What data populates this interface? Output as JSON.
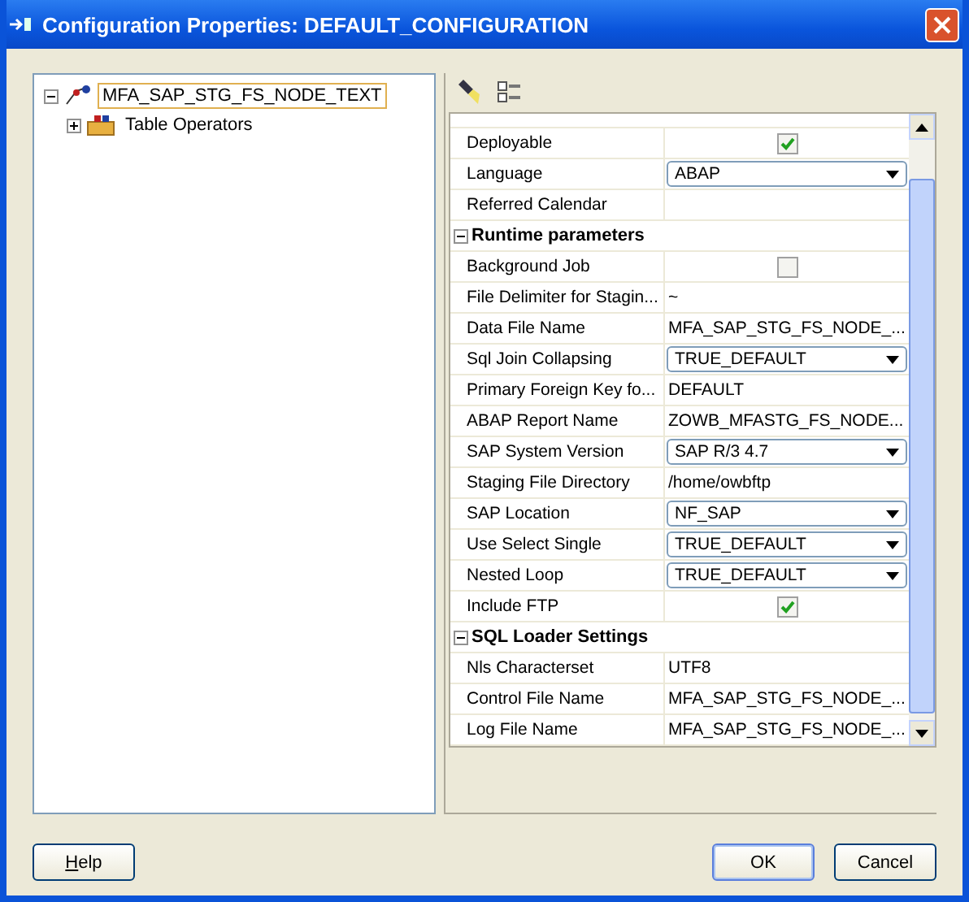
{
  "window": {
    "title": "Configuration Properties: DEFAULT_CONFIGURATION"
  },
  "tree": {
    "label": "MFA_SAP_STG_FS_NODE_TEXT",
    "expanded": true,
    "children": [
      {
        "label": "Table Operators",
        "expanded": false
      }
    ]
  },
  "properties": [
    {
      "kind": "check",
      "label": "Deployable",
      "checked": true
    },
    {
      "kind": "select",
      "label": "Language",
      "value": "ABAP"
    },
    {
      "kind": "text",
      "label": "Referred Calendar"
    },
    {
      "kind": "section",
      "label": "Runtime parameters",
      "expanded": true
    },
    {
      "kind": "check",
      "label": "Background Job",
      "checked": false
    },
    {
      "kind": "text",
      "label": "File Delimiter for Stagin...",
      "value": "~"
    },
    {
      "kind": "text",
      "label": "Data File Name",
      "value": "MFA_SAP_STG_FS_NODE_..."
    },
    {
      "kind": "select",
      "label": "Sql Join Collapsing",
      "value": "TRUE_DEFAULT"
    },
    {
      "kind": "text",
      "label": "Primary Foreign Key fo...",
      "value": "DEFAULT"
    },
    {
      "kind": "text",
      "label": "ABAP Report Name",
      "value": "ZOWB_MFASTG_FS_NODE..."
    },
    {
      "kind": "select",
      "label": "SAP System Version",
      "value": "SAP R/3 4.7"
    },
    {
      "kind": "text",
      "label": "Staging File Directory",
      "value": "/home/owbftp"
    },
    {
      "kind": "select",
      "label": "SAP Location",
      "value": "NF_SAP"
    },
    {
      "kind": "select",
      "label": "Use Select Single",
      "value": "TRUE_DEFAULT"
    },
    {
      "kind": "select",
      "label": "Nested Loop",
      "value": "TRUE_DEFAULT"
    },
    {
      "kind": "check",
      "label": "Include FTP",
      "checked": true
    },
    {
      "kind": "section",
      "label": "SQL Loader Settings",
      "expanded": true
    },
    {
      "kind": "text",
      "label": "Nls Characterset",
      "value": "UTF8"
    },
    {
      "kind": "text",
      "label": "Control File Name",
      "value": "MFA_SAP_STG_FS_NODE_..."
    },
    {
      "kind": "text",
      "label": "Log File Name",
      "value": "MFA_SAP_STG_FS_NODE_..."
    }
  ],
  "buttons": [
    {
      "label": "Help",
      "kind": "help"
    },
    {
      "label": "OK",
      "kind": "default"
    },
    {
      "label": "Cancel",
      "kind": "normal"
    }
  ]
}
